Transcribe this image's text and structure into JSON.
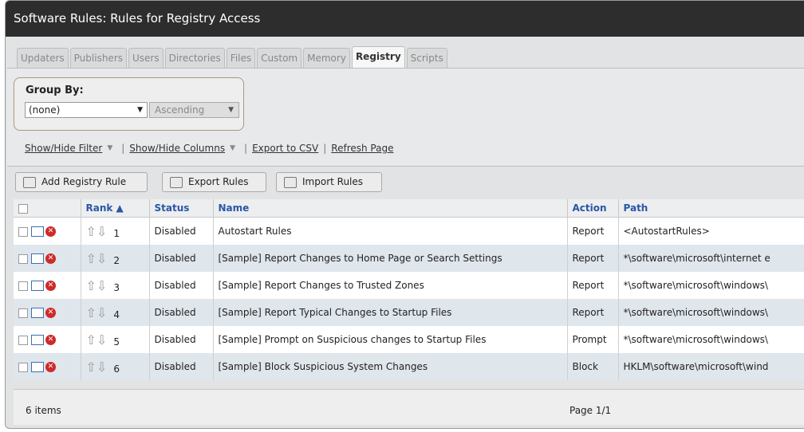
{
  "window": {
    "title": "Software Rules: Rules for Registry Access"
  },
  "tabs": [
    {
      "label": "Updaters"
    },
    {
      "label": "Publishers"
    },
    {
      "label": "Users"
    },
    {
      "label": "Directories"
    },
    {
      "label": "Files"
    },
    {
      "label": "Custom"
    },
    {
      "label": "Memory"
    },
    {
      "label": "Registry",
      "active": true
    },
    {
      "label": "Scripts"
    }
  ],
  "group_by": {
    "label": "Group By:",
    "field_value": "(none)",
    "order_value": "Ascending"
  },
  "links": {
    "show_hide_filter": "Show/Hide Filter",
    "show_hide_columns": "Show/Hide Columns",
    "export_csv": "Export to CSV",
    "refresh_page": "Refresh Page",
    "separator": "|"
  },
  "toolbar": {
    "add_rule": "Add Registry Rule",
    "export_rules": "Export Rules",
    "import_rules": "Import Rules"
  },
  "table": {
    "headers": {
      "rank": "Rank ▲",
      "status": "Status",
      "name": "Name",
      "action": "Action",
      "path": "Path"
    },
    "rows": [
      {
        "rank": "1",
        "status": "Disabled",
        "name": "Autostart Rules",
        "action": "Report",
        "path": "<AutostartRules>"
      },
      {
        "rank": "2",
        "status": "Disabled",
        "name": "[Sample] Report Changes to Home Page or Search Settings",
        "action": "Report",
        "path": "*\\software\\microsoft\\internet e"
      },
      {
        "rank": "3",
        "status": "Disabled",
        "name": "[Sample] Report Changes to Trusted Zones",
        "action": "Report",
        "path": "*\\software\\microsoft\\windows\\"
      },
      {
        "rank": "4",
        "status": "Disabled",
        "name": "[Sample] Report Typical Changes to Startup Files",
        "action": "Report",
        "path": "*\\software\\microsoft\\windows\\"
      },
      {
        "rank": "5",
        "status": "Disabled",
        "name": "[Sample] Prompt on Suspicious changes to Startup Files",
        "action": "Prompt",
        "path": "*\\software\\microsoft\\windows\\"
      },
      {
        "rank": "6",
        "status": "Disabled",
        "name": "[Sample] Block Suspicious System Changes",
        "action": "Block",
        "path": "HKLM\\software\\microsoft\\wind"
      }
    ]
  },
  "footer": {
    "item_count": "6 items",
    "page": "Page 1/1"
  },
  "icons": {
    "edit": "edit-icon",
    "delete": "delete-icon",
    "up": "arrow-up-icon",
    "down": "arrow-down-icon"
  },
  "colors": {
    "title_bar": "#2d2d2e",
    "header_text": "#2a56a5",
    "delete_icon": "#cf2a2a",
    "alt_row": "#dfe6ec"
  }
}
